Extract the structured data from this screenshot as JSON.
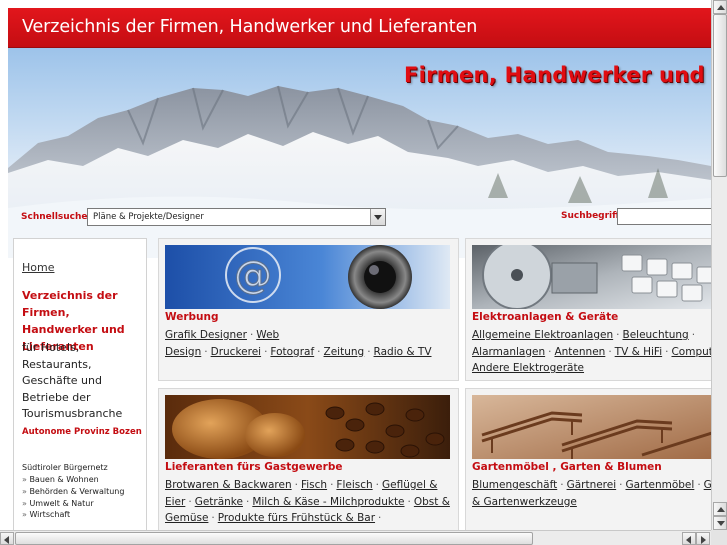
{
  "header": {
    "title": "Verzeichnis der Firmen, Handwerker und Lieferanten",
    "banner_slogan": "Firmen, Handwerker und Lieferanten"
  },
  "search": {
    "quick_label": "Schnellsuche:",
    "quick_selected": "Pläne & Projekte/Designer",
    "term_label": "Suchbegriff:",
    "term_value": ""
  },
  "sidebar": {
    "home": "Home",
    "title": "Verzeichnis der Firmen, Handwerker und Lieferanten",
    "desc": "für Hotels, Restaurants, Geschäfte und Betriebe der Tourismusbranche",
    "province": "Autonome Provinz Bozen",
    "network": "Südtiroler Bürgernetz",
    "items": [
      "Bauen & Wohnen",
      "Behörden & Verwaltung",
      "Umwelt & Natur",
      "Wirtschaft"
    ]
  },
  "panels": [
    {
      "title": "Werbung",
      "links": [
        "Grafik Designer",
        "Web Design",
        "Druckerei",
        "Fotograf",
        "Zeitung",
        "Radio & TV"
      ]
    },
    {
      "title": "Elektroanlagen & Geräte",
      "links": [
        "Allgemeine Elektroanlagen",
        "Beleuchtung",
        "Alarmanlagen",
        "Antennen",
        "TV & HiFi",
        "Computer",
        "Andere Elektrogeräte"
      ]
    },
    {
      "title": "Lieferanten fürs Gastgewerbe",
      "links": [
        "Brotwaren & Backwaren",
        "Fisch",
        "Fleisch",
        "Geflügel & Eier",
        "Getränke",
        "Milch & Käse - Milchprodukte",
        "Obst & Gemüse",
        "Produkte fürs Frühstück & Bar"
      ]
    },
    {
      "title": "Gartenmöbel , Garten & Blumen",
      "links": [
        "Blumengeschäft",
        "Gärtnerei",
        "Gartenmöbel",
        "Gartengeräte & Gartenwerkzeuge"
      ]
    }
  ],
  "colors": {
    "accent": "#c40d12",
    "title_bar": "#e2161c"
  },
  "icons": [
    "dropdown-arrow-icon",
    "scroll-up-icon",
    "scroll-down-icon",
    "scroll-left-icon",
    "scroll-right-icon"
  ]
}
